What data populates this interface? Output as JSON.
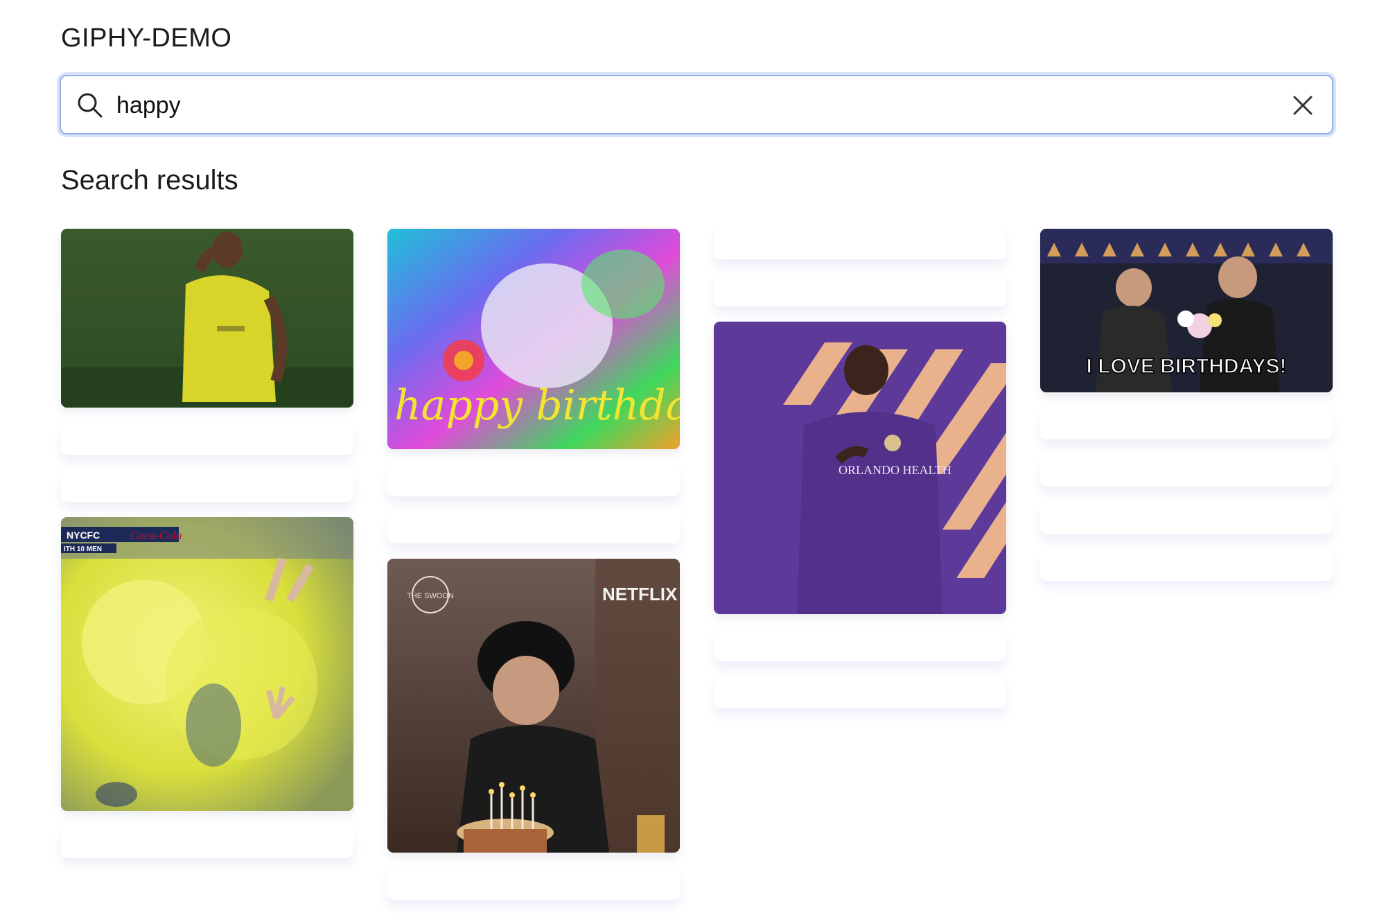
{
  "app": {
    "title": "GIPHY-DEMO"
  },
  "search": {
    "value": "happy",
    "placeholder": ""
  },
  "results": {
    "heading": "Search results",
    "gifs": {
      "netflix_label": "NETFLIX",
      "swoon_label": "THE SWOON",
      "birthday_caption": "I LOVE BIRTHDAYS!",
      "happy_birthday_script": "happy birthday",
      "orlando_label": "ORLANDO HEALTH",
      "nycfc_label": "NYCFC",
      "nycfc_sub": "ITH 10 MEN",
      "coke_label": "Coca-Cola"
    }
  },
  "colors": {
    "focus_border": "#8fb0e8",
    "focus_ring": "#d6e3fb",
    "placeholder_shadow": "rgba(90,110,200,0.10)"
  },
  "icons": {
    "search": "search-icon",
    "clear": "close-icon"
  }
}
